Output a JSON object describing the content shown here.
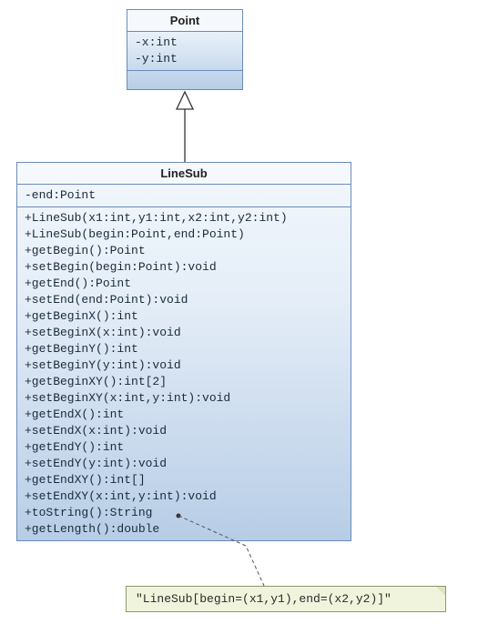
{
  "classes": {
    "point": {
      "name": "Point",
      "attributes": [
        "-x:int",
        "-y:int"
      ],
      "operations": []
    },
    "linesub": {
      "name": "LineSub",
      "attributes": [
        "-end:Point"
      ],
      "operations": [
        "+LineSub(x1:int,y1:int,x2:int,y2:int)",
        "+LineSub(begin:Point,end:Point)",
        "+getBegin():Point",
        "+setBegin(begin:Point):void",
        "+getEnd():Point",
        "+setEnd(end:Point):void",
        "+getBeginX():int",
        "+setBeginX(x:int):void",
        "+getBeginY():int",
        "+setBeginY(y:int):void",
        "+getBeginXY():int[2]",
        "+setBeginXY(x:int,y:int):void",
        "+getEndX():int",
        "+setEndX(x:int):void",
        "+getEndY():int",
        "+setEndY(y:int):void",
        "+getEndXY():int[]",
        "+setEndXY(x:int,y:int):void",
        "+toString():String",
        "+getLength():double"
      ]
    }
  },
  "note": {
    "text": "\"LineSub[begin=(x1,y1),end=(x2,y2)]\"",
    "attached_to_member": "toString"
  },
  "relationships": [
    {
      "type": "generalization",
      "from": "LineSub",
      "to": "Point"
    }
  ],
  "chart_data": {
    "type": "uml_class_diagram",
    "classes": [
      {
        "name": "Point",
        "attributes": [
          {
            "visibility": "-",
            "name": "x",
            "type": "int"
          },
          {
            "visibility": "-",
            "name": "y",
            "type": "int"
          }
        ],
        "operations": []
      },
      {
        "name": "LineSub",
        "attributes": [
          {
            "visibility": "-",
            "name": "end",
            "type": "Point"
          }
        ],
        "operations": [
          {
            "visibility": "+",
            "signature": "LineSub(x1:int,y1:int,x2:int,y2:int)"
          },
          {
            "visibility": "+",
            "signature": "LineSub(begin:Point,end:Point)"
          },
          {
            "visibility": "+",
            "signature": "getBegin():Point"
          },
          {
            "visibility": "+",
            "signature": "setBegin(begin:Point):void"
          },
          {
            "visibility": "+",
            "signature": "getEnd():Point"
          },
          {
            "visibility": "+",
            "signature": "setEnd(end:Point):void"
          },
          {
            "visibility": "+",
            "signature": "getBeginX():int"
          },
          {
            "visibility": "+",
            "signature": "setBeginX(x:int):void"
          },
          {
            "visibility": "+",
            "signature": "getBeginY():int"
          },
          {
            "visibility": "+",
            "signature": "setBeginY(y:int):void"
          },
          {
            "visibility": "+",
            "signature": "getBeginXY():int[2]"
          },
          {
            "visibility": "+",
            "signature": "setBeginXY(x:int,y:int):void"
          },
          {
            "visibility": "+",
            "signature": "getEndX():int"
          },
          {
            "visibility": "+",
            "signature": "setEndX(x:int):void"
          },
          {
            "visibility": "+",
            "signature": "getEndY():int"
          },
          {
            "visibility": "+",
            "signature": "setEndY(y:int):void"
          },
          {
            "visibility": "+",
            "signature": "getEndXY():int[]"
          },
          {
            "visibility": "+",
            "signature": "setEndXY(x:int,y:int):void"
          },
          {
            "visibility": "+",
            "signature": "toString():String"
          },
          {
            "visibility": "+",
            "signature": "getLength():double"
          }
        ]
      }
    ],
    "relationships": [
      {
        "type": "generalization",
        "child": "LineSub",
        "parent": "Point"
      }
    ],
    "notes": [
      {
        "text": "\"LineSub[begin=(x1,y1),end=(x2,y2)]\"",
        "attached_to": "LineSub.toString()"
      }
    ]
  }
}
